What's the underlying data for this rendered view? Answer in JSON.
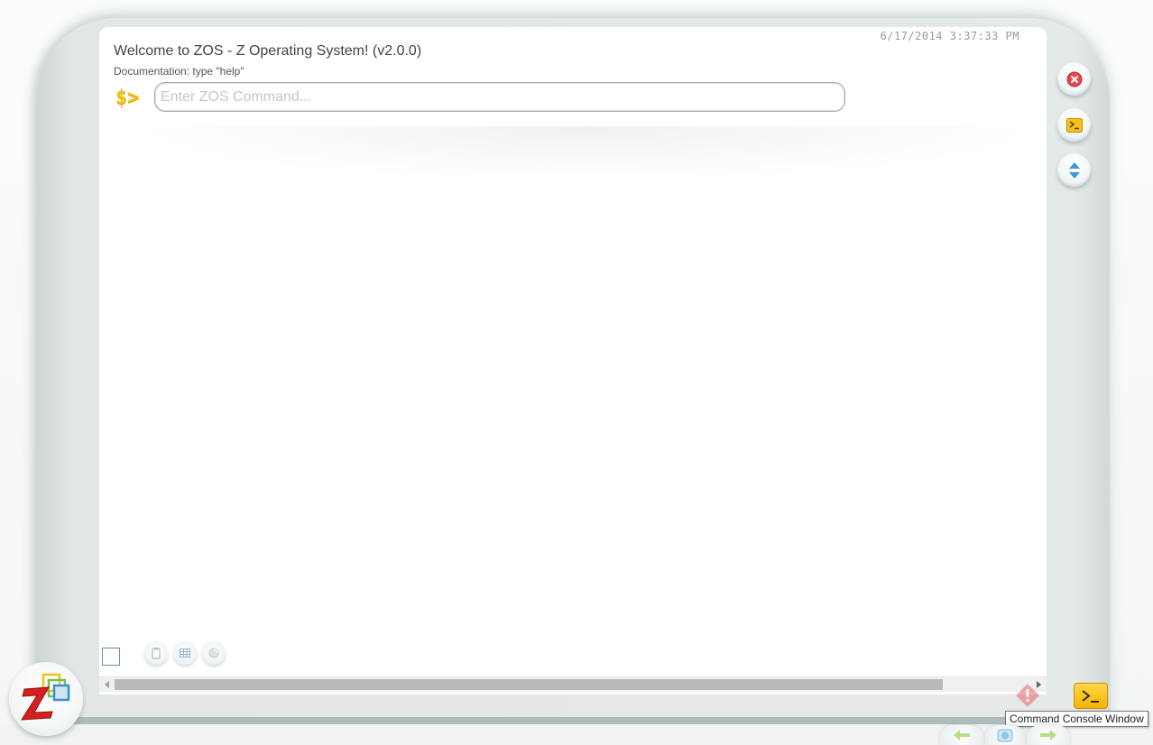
{
  "console": {
    "timestamp": "6/17/2014 3:37:33 PM",
    "welcome": "Welcome to ZOS - Z Operating System! (v2.0.0)",
    "doc_hint": "Documentation: type \"help\"",
    "prompt": "$>",
    "command_placeholder": "Enter ZOS Command...",
    "command_value": ""
  },
  "side_buttons": [
    {
      "name": "close-button",
      "icon": "close-icon",
      "color": "#e84848"
    },
    {
      "name": "console-button",
      "icon": "terminal-icon",
      "color": "#f3b400"
    },
    {
      "name": "resize-button",
      "icon": "up-down-arrows-icon",
      "color": "#3a9ad9"
    }
  ],
  "mini_tools": [
    {
      "name": "clipboard-tool-button",
      "icon": "clipboard-icon"
    },
    {
      "name": "grid-tool-button",
      "icon": "grid-icon"
    },
    {
      "name": "refresh-tool-button",
      "icon": "refresh-icon"
    }
  ],
  "tray": {
    "tooltip": "Command Console Window",
    "console_icon": "terminal-icon",
    "warning_icon": "warning-icon"
  },
  "nav": {
    "back_icon": "back-arrow-icon",
    "home_icon": "home-icon",
    "forward_icon": "forward-arrow-icon"
  },
  "logo": {
    "icon": "zos-logo-icon",
    "letter": "Z"
  },
  "colors": {
    "prompt": "#f0c419",
    "frame": "#e2e6e6",
    "accent_yellow": "#f3b400"
  }
}
